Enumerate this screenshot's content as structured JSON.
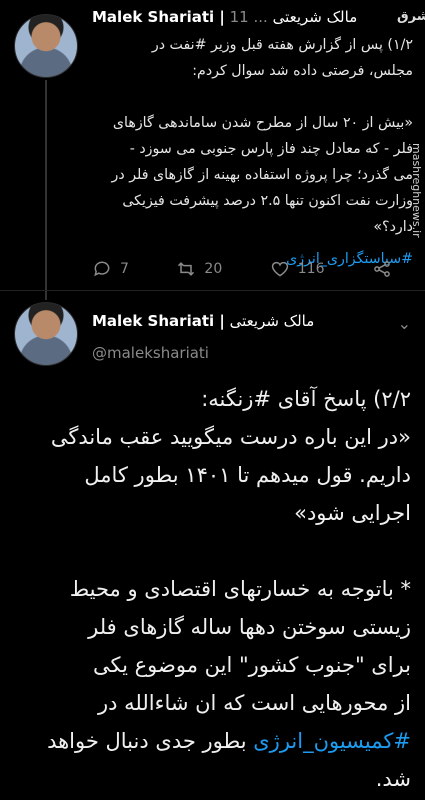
{
  "tweet1": {
    "author_en": "Malek Shariati |",
    "author_fa": "مالک شریعتی",
    "meta": "... 11",
    "lines": [
      "۱/۲) پس از گزارش هفته قبل وزیر #نفت در",
      "مجلس، فرصتی داده شد سوال کردم:",
      "",
      "«بیش از ۲۰ سال از مطرح شدن ساماندهی گازهای",
      "فلر - که معادل چند فاز پارس جنوبی می سوزد -",
      "می گذرد؛ چرا پروژه استفاده بهینه از گازهای فلر در",
      "وزارت نفت اکنون تنها ۲.۵ درصد پیشرفت فیزیکی",
      "دارد؟»"
    ],
    "hashtag": "#سیاستگزاری_انرژی",
    "replies": "7",
    "retweets": "20",
    "likes": "116"
  },
  "tweet2": {
    "author_en": "Malek Shariati |",
    "author_fa": "مالک شریعتی",
    "handle": "@malekshariati",
    "line1": "۲/۲) پاسخ آقای #زنگنه:",
    "line2": "«در این باره درست میگویید عقب ماندگی",
    "line3": "داریم. قول میدهم تا ۱۴۰۱ بطور کامل",
    "line4": "اجرایی شود»",
    "line5": "* باتوجه به خسارتهای اقتصادی و محیط",
    "line6": "زیستی سوختن دهها ساله گازهای فلر",
    "line7": "برای \"جنوب کشور\" این موضوع یکی",
    "line8": "از محورهایی است که ان شاءالله در",
    "line9_hash": "#کمیسیون_انرژی",
    "line9_rest": " بطور جدی دنبال خواهد",
    "line10": "شد."
  },
  "watermark": {
    "logo": "مشرق",
    "site": "mashreghnews.ir"
  }
}
